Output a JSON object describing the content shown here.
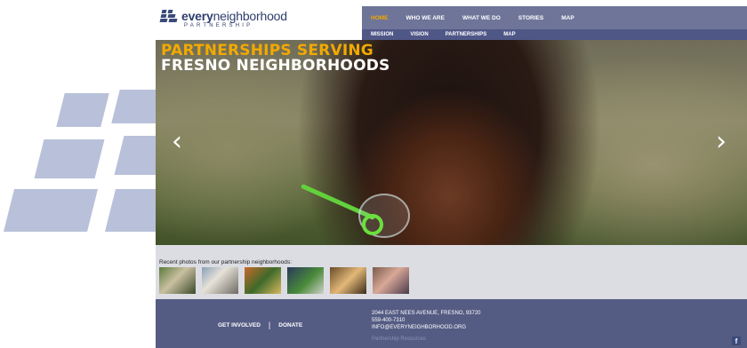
{
  "logo": {
    "word_bold": "every",
    "word_light": "neighborhood",
    "subtitle": "PARTNERSHIP"
  },
  "nav": {
    "top": [
      {
        "label": "HOME",
        "active": true
      },
      {
        "label": "WHO WE ARE",
        "active": false
      },
      {
        "label": "WHAT WE DO",
        "active": false
      },
      {
        "label": "STORIES",
        "active": false
      },
      {
        "label": "MAP",
        "active": false
      }
    ],
    "sub": [
      {
        "label": "MISSION"
      },
      {
        "label": "VISION"
      },
      {
        "label": "PARTNERSHIPS"
      },
      {
        "label": "MAP"
      }
    ]
  },
  "hero": {
    "title_line1": "PARTNERSHIPS SERVING",
    "title_line2": "FRESNO NEIGHBORHOODS",
    "prev_icon": "chevron-left-icon",
    "next_icon": "chevron-right-icon",
    "prev_glyph": "‹",
    "next_glyph": "›"
  },
  "photos": {
    "label": "Recent photos from our partnership neighborhoods:",
    "thumbnails": [
      "photo-1",
      "photo-2",
      "photo-3",
      "photo-4",
      "photo-5",
      "photo-6"
    ]
  },
  "footer": {
    "get_involved": "GET INVOLVED",
    "separator": "|",
    "donate": "DONATE",
    "address_line1": "2044 EAST NEES AVENUE, FRESNO, 93720",
    "address_line2": "559-400-7310",
    "address_line3": "INFO@EVERYNEIGHBORHOOD.ORG",
    "resources": "Partnership Resources",
    "facebook_glyph": "f"
  },
  "colors": {
    "nav_top_bg": "#6f7599",
    "nav_sub_bg": "#4f5787",
    "accent": "#f2a900",
    "footer_bg": "#555c84",
    "strip_bg": "#dcdde3"
  }
}
